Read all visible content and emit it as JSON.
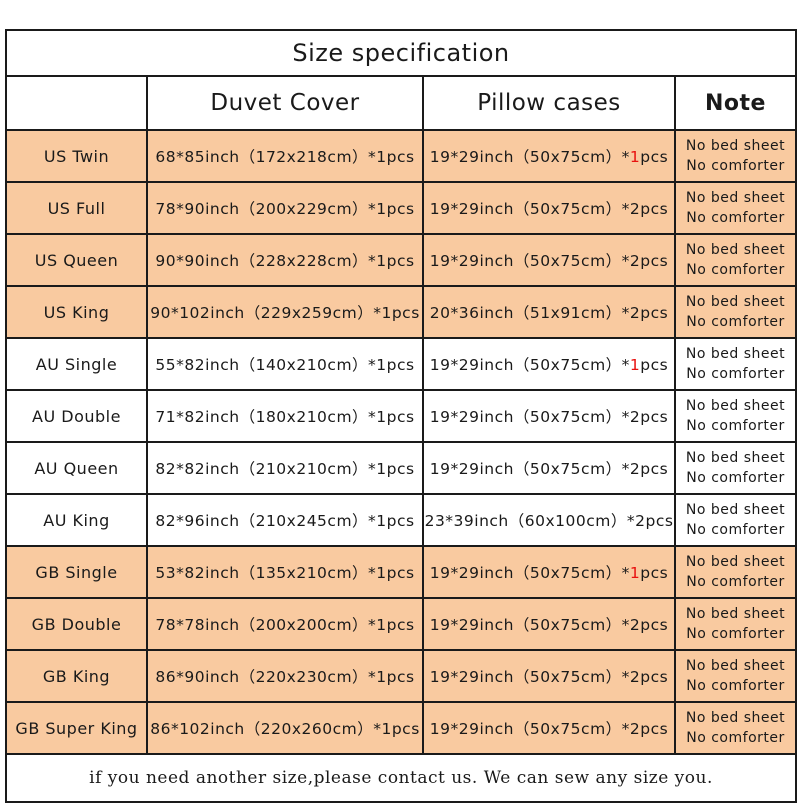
{
  "table": {
    "title": "Size specification",
    "columns": {
      "size": "",
      "duvet": "Duvet Cover",
      "pillow": "Pillow cases",
      "note": "Note"
    },
    "note_text": {
      "line1": "No bed sheet",
      "line2": "No comforter"
    },
    "rows": [
      {
        "size": "US Twin",
        "duvet": "68*85inch（172x218cm）*1pcs",
        "pillow_prefix": "19*29inch（50x75cm）*",
        "pillow_count": "1",
        "pillow_suffix": "pcs",
        "pillow_count_red": true,
        "shade": "orange"
      },
      {
        "size": "US Full",
        "duvet": "78*90inch（200x229cm）*1pcs",
        "pillow_prefix": "19*29inch（50x75cm）*",
        "pillow_count": "2",
        "pillow_suffix": "pcs",
        "pillow_count_red": false,
        "shade": "orange"
      },
      {
        "size": "US Queen",
        "duvet": "90*90inch（228x228cm）*1pcs",
        "pillow_prefix": "19*29inch（50x75cm）*",
        "pillow_count": "2",
        "pillow_suffix": "pcs",
        "pillow_count_red": false,
        "shade": "orange"
      },
      {
        "size": "US King",
        "duvet": "90*102inch（229x259cm）*1pcs",
        "pillow_prefix": "20*36inch（51x91cm）*",
        "pillow_count": "2",
        "pillow_suffix": "pcs",
        "pillow_count_red": false,
        "shade": "orange"
      },
      {
        "size": "AU Single",
        "duvet": "55*82inch（140x210cm）*1pcs",
        "pillow_prefix": "19*29inch（50x75cm）*",
        "pillow_count": "1",
        "pillow_suffix": "pcs",
        "pillow_count_red": true,
        "shade": "white"
      },
      {
        "size": "AU Double",
        "duvet": "71*82inch（180x210cm）*1pcs",
        "pillow_prefix": "19*29inch（50x75cm）*",
        "pillow_count": "2",
        "pillow_suffix": "pcs",
        "pillow_count_red": false,
        "shade": "white"
      },
      {
        "size": "AU Queen",
        "duvet": "82*82inch（210x210cm）*1pcs",
        "pillow_prefix": "19*29inch（50x75cm）*",
        "pillow_count": "2",
        "pillow_suffix": "pcs",
        "pillow_count_red": false,
        "shade": "white"
      },
      {
        "size": "AU King",
        "duvet": "82*96inch（210x245cm）*1pcs",
        "pillow_prefix": "23*39inch（60x100cm）*",
        "pillow_count": "2",
        "pillow_suffix": "pcs",
        "pillow_count_red": false,
        "shade": "white"
      },
      {
        "size": "GB Single",
        "duvet": "53*82inch（135x210cm）*1pcs",
        "pillow_prefix": "19*29inch（50x75cm）*",
        "pillow_count": "1",
        "pillow_suffix": "pcs",
        "pillow_count_red": true,
        "shade": "orange"
      },
      {
        "size": "GB Double",
        "duvet": "78*78inch（200x200cm）*1pcs",
        "pillow_prefix": "19*29inch（50x75cm）*",
        "pillow_count": "2",
        "pillow_suffix": "pcs",
        "pillow_count_red": false,
        "shade": "orange"
      },
      {
        "size": "GB King",
        "duvet": "86*90inch（220x230cm）*1pcs",
        "pillow_prefix": "19*29inch（50x75cm）*",
        "pillow_count": "2",
        "pillow_suffix": "pcs",
        "pillow_count_red": false,
        "shade": "orange"
      },
      {
        "size": "GB Super King",
        "duvet": "86*102inch（220x260cm）*1pcs",
        "pillow_prefix": "19*29inch（50x75cm）*",
        "pillow_count": "2",
        "pillow_suffix": "pcs",
        "pillow_count_red": false,
        "shade": "orange"
      }
    ],
    "footer": "if you need another size,please contact us. We can sew any size you."
  },
  "colors": {
    "row_shade": "#f9caa0",
    "accent_red": "#e8110f",
    "border": "#1a1a1a",
    "background": "#ffffff"
  }
}
